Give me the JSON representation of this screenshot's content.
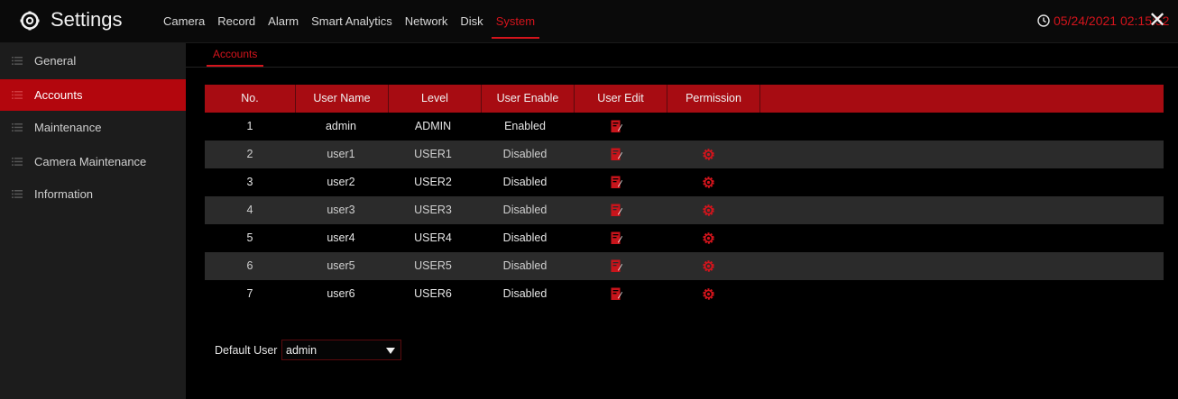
{
  "header": {
    "title": "Settings",
    "tabs": [
      {
        "label": "Camera"
      },
      {
        "label": "Record"
      },
      {
        "label": "Alarm"
      },
      {
        "label": "Smart Analytics"
      },
      {
        "label": "Network"
      },
      {
        "label": "Disk"
      },
      {
        "label": "System",
        "active": true
      }
    ],
    "datetime": "05/24/2021 02:15:52",
    "close_label": "✕"
  },
  "sidebar": {
    "items": [
      {
        "label": "General"
      },
      {
        "label": "Accounts",
        "active": true
      },
      {
        "label": "Maintenance"
      },
      {
        "label": "Camera Maintenance"
      },
      {
        "label": "Information"
      }
    ]
  },
  "subtab": {
    "label": "Accounts"
  },
  "table": {
    "headers": [
      "No.",
      "User Name",
      "Level",
      "User Enable",
      "User Edit",
      "Permission"
    ],
    "rows": [
      {
        "no": "1",
        "name": "admin",
        "level": "ADMIN",
        "enable": "Enabled"
      },
      {
        "no": "2",
        "name": "user1",
        "level": "USER1",
        "enable": "Disabled"
      },
      {
        "no": "3",
        "name": "user2",
        "level": "USER2",
        "enable": "Disabled"
      },
      {
        "no": "4",
        "name": "user3",
        "level": "USER3",
        "enable": "Disabled"
      },
      {
        "no": "5",
        "name": "user4",
        "level": "USER4",
        "enable": "Disabled"
      },
      {
        "no": "6",
        "name": "user5",
        "level": "USER5",
        "enable": "Disabled"
      },
      {
        "no": "7",
        "name": "user6",
        "level": "USER6",
        "enable": "Disabled"
      }
    ]
  },
  "default_user": {
    "label": "Default User",
    "value": "admin"
  },
  "colors": {
    "accent": "#d4141c",
    "header_bg": "#a70c12",
    "active_sidebar": "#b3060d"
  },
  "icons": {
    "app": "settings-gear-icon",
    "clock": "clock-icon",
    "edit": "edit-icon",
    "permission": "gear-icon"
  }
}
